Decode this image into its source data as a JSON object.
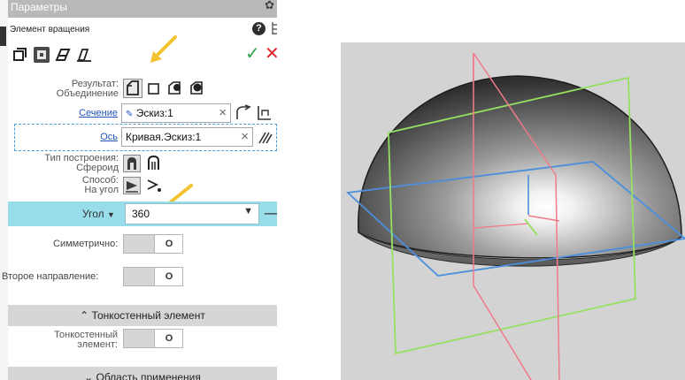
{
  "panel": {
    "title": "Параметры",
    "element_name": "Элемент вращения",
    "result": {
      "label": "Результат:",
      "value": "Объединение"
    },
    "section_link": "Сечение",
    "sketch_value": "Эскиз:1",
    "axis_link": "Ось",
    "axis_value": "Кривая.Эскиз:1",
    "build_type": {
      "label": "Тип построения:",
      "value": "Сфероид"
    },
    "method": {
      "label": "Способ:",
      "value": "На угол"
    },
    "angle_label": "Угол",
    "angle_value": "360",
    "symmetric_label": "Симметрично:",
    "second_dir_label": "Второе направление:",
    "thin_section": "Тонкостенный элемент",
    "thin_line1": "Тонкостенный",
    "thin_line2": "элемент:",
    "area_section": "Область применения",
    "toggle_knob": "O",
    "colors": {
      "accent_row": "#99dcea",
      "ok": "#2ea14a",
      "cancel": "#e0242b",
      "link": "#2255bb",
      "arrow": "#f2c230"
    }
  },
  "viewport": {
    "shape": "hemisphere",
    "colors": {
      "plane_green": "#96e060",
      "plane_red": "#f07a8a",
      "plane_blue": "#4b8fdc",
      "background": "#d3d3d3"
    }
  }
}
